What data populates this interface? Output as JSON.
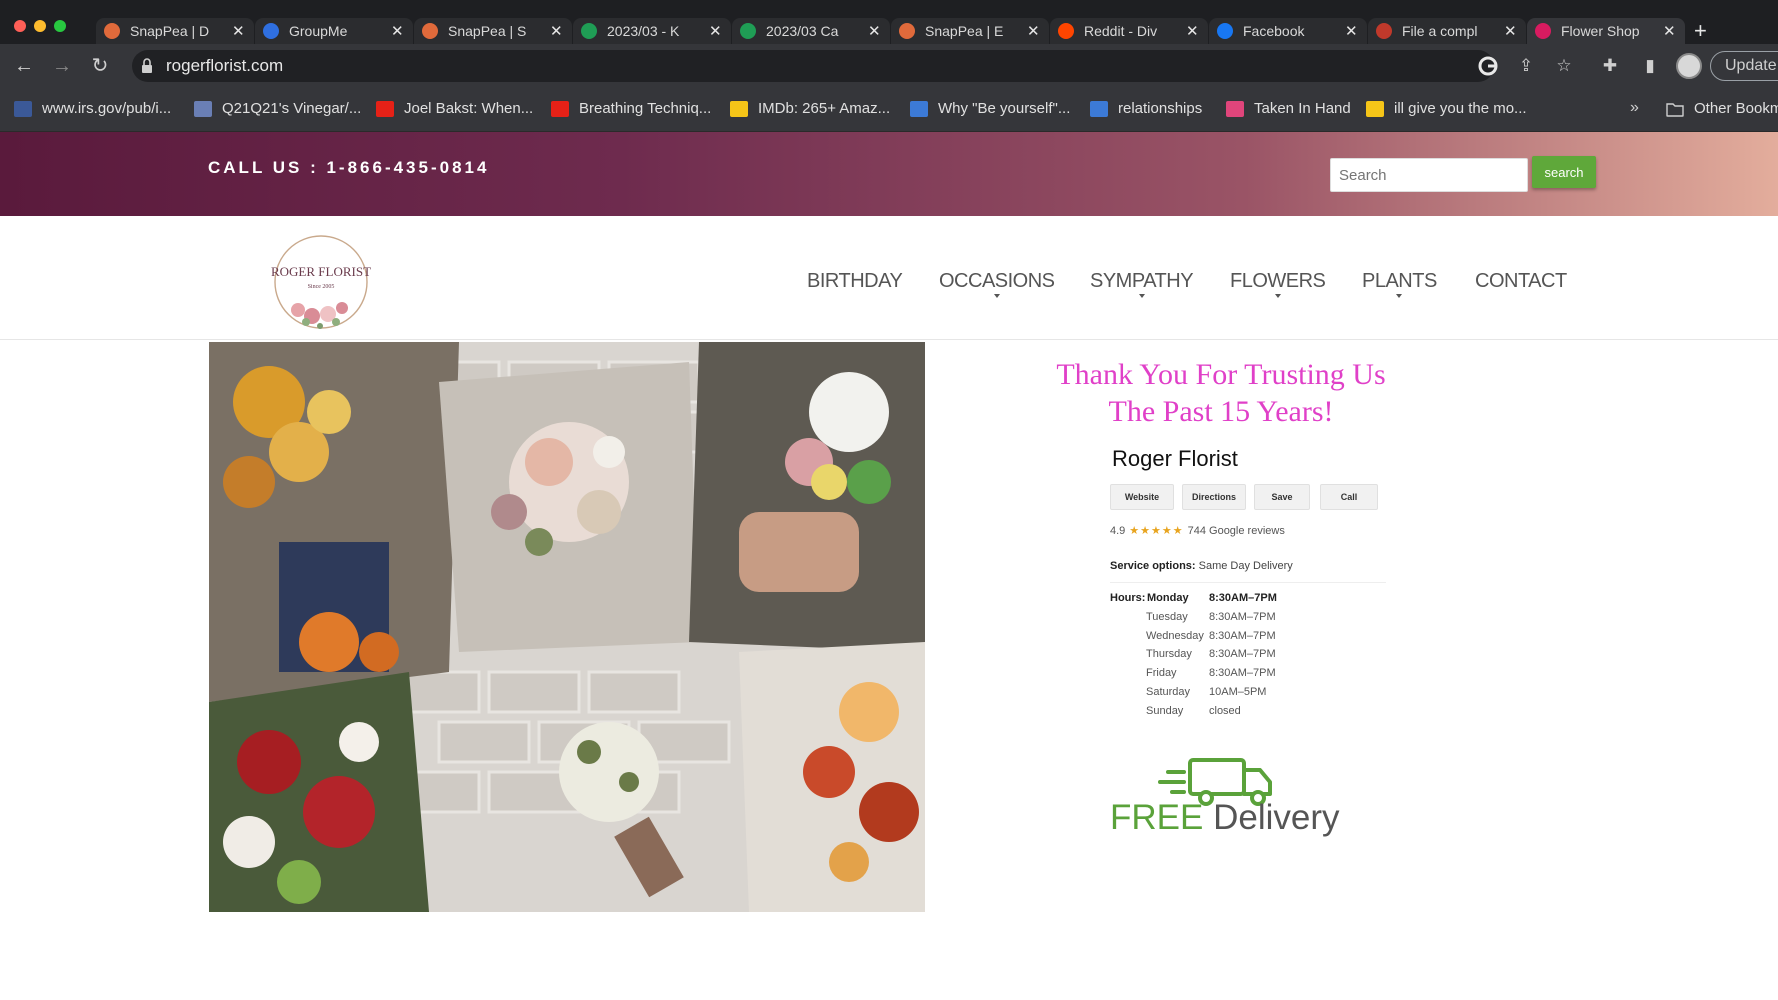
{
  "browser": {
    "tabs": [
      {
        "title": "SnapPea | D",
        "favicon_color": "#e06a3b"
      },
      {
        "title": "GroupMe",
        "favicon_color": "#2f6fe0"
      },
      {
        "title": "SnapPea | S",
        "favicon_color": "#e06a3b"
      },
      {
        "title": "2023/03 - K",
        "favicon_color": "#1f9d55"
      },
      {
        "title": "2023/03 Ca",
        "favicon_color": "#1f9d55"
      },
      {
        "title": "SnapPea | E",
        "favicon_color": "#e06a3b"
      },
      {
        "title": "Reddit - Div",
        "favicon_color": "#ff4500"
      },
      {
        "title": "Facebook",
        "favicon_color": "#1877f2"
      },
      {
        "title": "File a compl",
        "favicon_color": "#c0392b"
      },
      {
        "title": "Flower Shop",
        "favicon_color": "#d81b60"
      }
    ],
    "url": "rogerflorist.com",
    "update_label": "Update",
    "bookmarks": [
      {
        "label": "www.irs.gov/pub/i...",
        "color": "#3b5998"
      },
      {
        "label": "Q21Q21's Vinegar/...",
        "color": "#6a7fb5"
      },
      {
        "label": "Joel Bakst: When...",
        "color": "#e62117"
      },
      {
        "label": "Breathing Techniq...",
        "color": "#e62117"
      },
      {
        "label": "IMDb: 265+ Amaz...",
        "color": "#f5c518"
      },
      {
        "label": "Why \"Be yourself\"...",
        "color": "#3c7ad6"
      },
      {
        "label": "relationships",
        "color": "#3c7ad6"
      },
      {
        "label": "Taken In Hand",
        "color": "#e0457b"
      },
      {
        "label": "ill give you the mo...",
        "color": "#f5c518"
      }
    ],
    "more_bookmarks": "»",
    "other_bookmarks": "Other Bookm"
  },
  "site": {
    "call_us": "CALL US : 1-866-435-0814",
    "search_placeholder": "Search",
    "search_button": "search",
    "logo_name": "ROGER FLORIST",
    "logo_since": "Since 2005",
    "nav": [
      {
        "label": "BIRTHDAY",
        "has_dropdown": false
      },
      {
        "label": "OCCASIONS",
        "has_dropdown": true
      },
      {
        "label": "SYMPATHY",
        "has_dropdown": true
      },
      {
        "label": "FLOWERS",
        "has_dropdown": true
      },
      {
        "label": "PLANTS",
        "has_dropdown": true
      },
      {
        "label": "CONTACT",
        "has_dropdown": false
      }
    ],
    "thanks_line1": "Thank You For Trusting Us",
    "thanks_line2": "The Past 15 Years!",
    "business_name": "Roger Florist",
    "actions": [
      "Website",
      "Directions",
      "Save",
      "Call"
    ],
    "rating_value": "4.9",
    "rating_stars": "★★★★★",
    "reviews": "744 Google reviews",
    "service_label": "Service options:",
    "service_value": "Same Day Delivery",
    "hours_label": "Hours:",
    "hours": [
      {
        "day": "Monday",
        "time": "8:30AM–7PM"
      },
      {
        "day": "Tuesday",
        "time": "8:30AM–7PM"
      },
      {
        "day": "Wednesday",
        "time": "8:30AM–7PM"
      },
      {
        "day": "Thursday",
        "time": "8:30AM–7PM"
      },
      {
        "day": "Friday",
        "time": "8:30AM–7PM"
      },
      {
        "day": "Saturday",
        "time": "10AM–5PM"
      },
      {
        "day": "Sunday",
        "time": "closed"
      }
    ],
    "free_word": "FREE",
    "delivery_word": "Delivery",
    "colors": {
      "accent_pink": "#e040c8",
      "green": "#5fa83a",
      "header_dark": "#5a1a3c"
    }
  }
}
